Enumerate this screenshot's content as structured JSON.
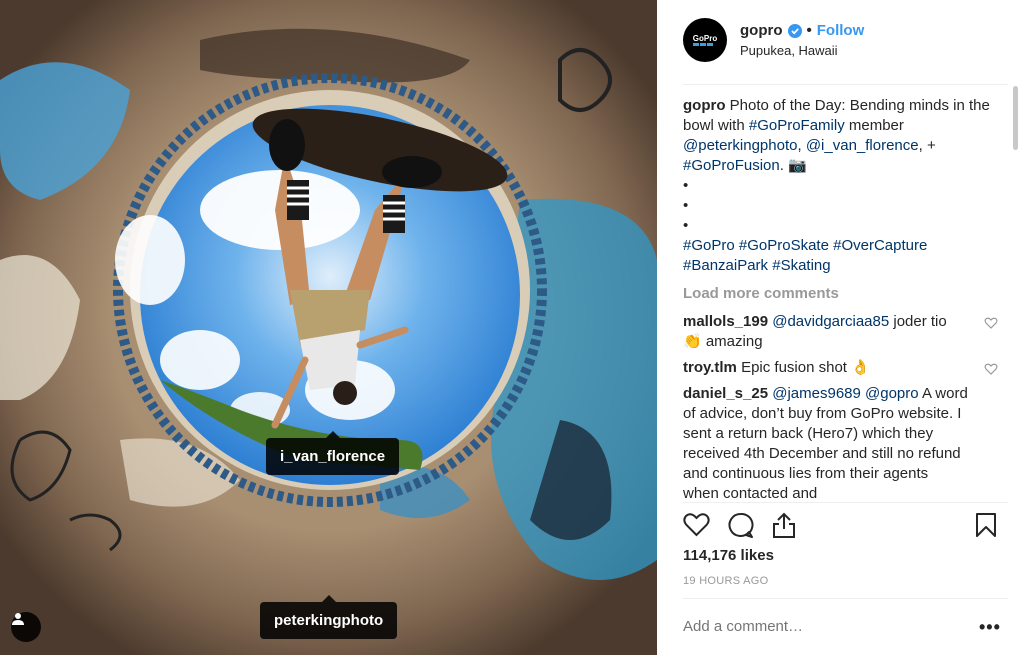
{
  "photo": {
    "tags": [
      "i_van_florence",
      "peterkingphoto"
    ],
    "user_tags_icon": "user-icon"
  },
  "header": {
    "username": "gopro",
    "verified_icon": "verified-badge-icon",
    "separator": "•",
    "follow_label": "Follow",
    "location": "Pupukea, Hawaii",
    "avatar_text": "GoPro"
  },
  "caption": {
    "username": "gopro",
    "text1": " Photo of the Day: Bending minds in the bowl with ",
    "tag1": "#GoProFamily",
    "text2": " member ",
    "mention1": "@peterkingphoto",
    "text3": ", ",
    "mention2": "@i_van_florence",
    "text4": ", + ",
    "tag2": "#GoProFusion",
    "text5": ". 📷",
    "bullets": [
      "•",
      "•",
      "•"
    ],
    "hashtags": [
      "#GoPro",
      "#GoProSkate",
      "#OverCapture",
      "#BanzaiPark",
      "#Skating"
    ]
  },
  "load_more": "Load more comments",
  "comments": [
    {
      "user": "mallols_199",
      "mention": "@davidgarciaa85",
      "text": " joder tio 👏 amazing"
    },
    {
      "user": "troy.tlm",
      "mention": "",
      "text": " Epic fusion shot 👌"
    },
    {
      "user": "daniel_s_25",
      "mention": "@james9689 @gopro",
      "text": " A word of advice, don’t buy from GoPro website. I sent a return back (Hero7) which they received 4th December and still no refund and continuous lies from their agents when contacted and"
    }
  ],
  "actions": {
    "like_icon": "heart-icon",
    "comment_icon": "comment-icon",
    "share_icon": "share-icon",
    "save_icon": "bookmark-icon"
  },
  "likes": "114,176 likes",
  "time": "19 HOURS AGO",
  "add_comment_placeholder": "Add a comment…",
  "more_label": "•••",
  "colors": {
    "link": "#003569",
    "follow": "#3897f0",
    "muted": "#999999"
  }
}
